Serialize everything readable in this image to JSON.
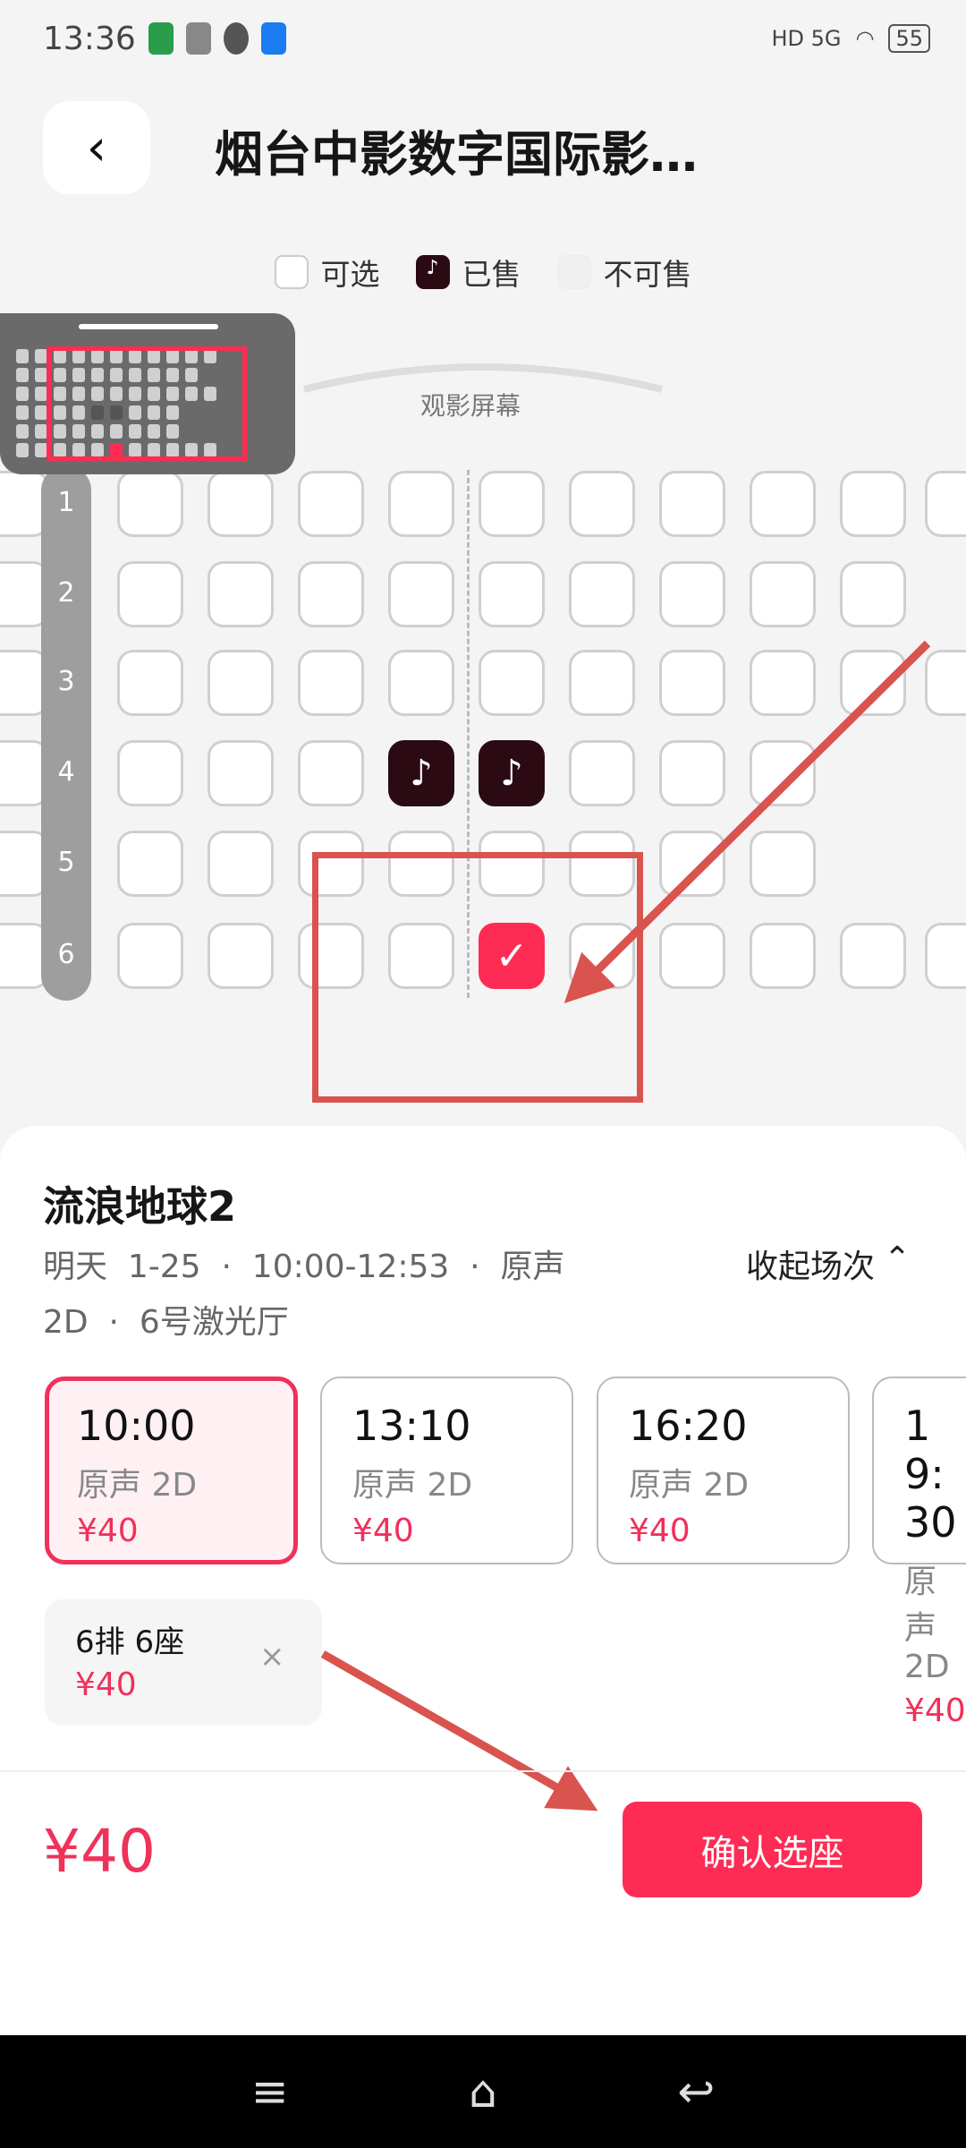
{
  "status_bar": {
    "time": "13:36",
    "battery": "55",
    "network": "HD 5G"
  },
  "header": {
    "title": "烟台中影数字国际影…"
  },
  "legend": [
    {
      "label": "可选"
    },
    {
      "label": "已售"
    },
    {
      "label": "不可售"
    }
  ],
  "screen_label": "观影屏幕",
  "rows": [
    "1",
    "2",
    "3",
    "4",
    "5",
    "6"
  ],
  "seat_states": {
    "sold": [
      "4排5座",
      "4排6座"
    ],
    "selected": [
      "6排6座"
    ]
  },
  "movie": {
    "title": "流浪地球2",
    "info_line1": "明天  1-25  ·  10:00-12:53  ·  原声",
    "info_line2": "2D  ·  6号激光厅",
    "collapse_label": "收起场次"
  },
  "sessions": [
    {
      "time": "10:00",
      "format": "原声  2D",
      "price": "¥40",
      "selected": true
    },
    {
      "time": "13:10",
      "format": "原声  2D",
      "price": "¥40"
    },
    {
      "time": "16:20",
      "format": "原声  2D",
      "price": "¥40"
    },
    {
      "time": "19:30",
      "format": "原声  2D",
      "price": "¥40"
    }
  ],
  "selected_seat": {
    "label": "6排  6座",
    "price": "¥40"
  },
  "footer": {
    "total": "¥40",
    "confirm_label": "确认选座"
  },
  "colors": {
    "accent": "#fe2c55",
    "sold": "#2b0a14",
    "annotation": "#d9534f"
  }
}
